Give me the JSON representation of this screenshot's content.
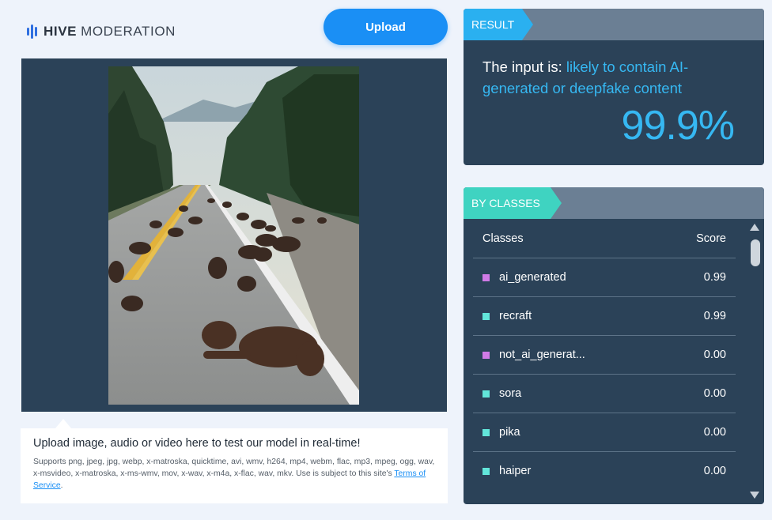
{
  "header": {
    "logo_brand": "HIVE",
    "logo_product": "MODERATION",
    "upload_label": "Upload"
  },
  "preview": {
    "image_description": "uploaded image preview"
  },
  "upload_info": {
    "title": "Upload image, audio or video here to test our model in real-time!",
    "desc_text": "Supports png, jpeg, jpg, webp, x-matroska, quicktime, avi, wmv, h264, mp4, webm, flac, mp3, mpeg, ogg, wav, x-msvideo, x-matroska, x-ms-wmv, mov, x-wav, x-m4a, x-flac, wav, mkv. Use is subject to this site's ",
    "terms_link": "Terms of Service",
    "desc_end": "."
  },
  "result": {
    "tag": "RESULT",
    "prefix": "The input is: ",
    "verdict": "likely to contain AI-generated or deepfake content",
    "score": "99.9%"
  },
  "classes": {
    "tag": "BY CLASSES",
    "col_class": "Classes",
    "col_score": "Score",
    "rows": [
      {
        "name": "ai_generated",
        "score": "0.99",
        "color": "#d07be6"
      },
      {
        "name": "recraft",
        "score": "0.99",
        "color": "#62e6da"
      },
      {
        "name": "not_ai_generat...",
        "score": "0.00",
        "color": "#d07be6"
      },
      {
        "name": "sora",
        "score": "0.00",
        "color": "#62e6da"
      },
      {
        "name": "pika",
        "score": "0.00",
        "color": "#62e6da"
      },
      {
        "name": "haiper",
        "score": "0.00",
        "color": "#62e6da"
      }
    ]
  },
  "colors": {
    "accent": "#1a8ff5",
    "panel": "#2b4258",
    "result_teal": "#2ab0f0",
    "classes_teal": "#3fd3c1"
  }
}
